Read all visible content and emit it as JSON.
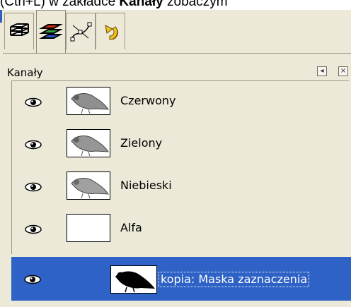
{
  "caption": {
    "part1": "(Ctrl+L) w zakładce ",
    "bold": "Kanały",
    "part2": " zobaczym"
  },
  "panel": {
    "title": "Kanały",
    "tabs": [
      {
        "name": "layers-tab",
        "icon": "layers-icon"
      },
      {
        "name": "channels-tab",
        "icon": "channels-icon",
        "active": true
      },
      {
        "name": "paths-tab",
        "icon": "paths-icon"
      },
      {
        "name": "undo-history-tab",
        "icon": "undo-icon"
      }
    ],
    "buttons": {
      "menu": "◂",
      "close": "×"
    }
  },
  "channels": [
    {
      "label": "Czerwony",
      "visible": true
    },
    {
      "label": "Zielony",
      "visible": true
    },
    {
      "label": "Niebieski",
      "visible": true
    },
    {
      "label": "Alfa",
      "visible": true
    }
  ],
  "selected_channel": {
    "label": "kopia: Maska zaznaczenia",
    "visible": true
  }
}
